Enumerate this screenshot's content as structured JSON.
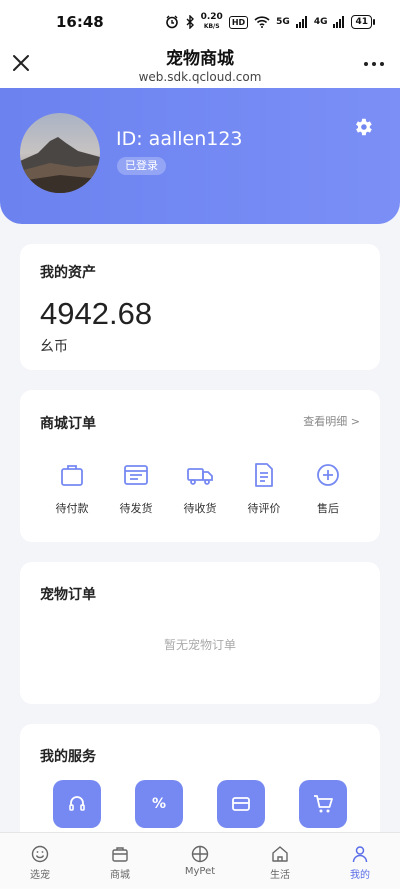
{
  "status_bar": {
    "time": "16:48",
    "speed_value": "0.20",
    "speed_unit": "KB/S",
    "hd": "HD",
    "net1": "5G",
    "net2": "4G",
    "battery": "41"
  },
  "title_bar": {
    "title": "宠物商城",
    "subtitle": "web.sdk.qcloud.com",
    "close_icon": "close-icon",
    "more_icon": "more-icon"
  },
  "profile": {
    "user_id": "ID: aallen123",
    "login_status": "已登录",
    "settings_icon": "gear-icon"
  },
  "assets": {
    "title": "我的资产",
    "value": "4942.68",
    "unit": "幺币"
  },
  "shop_orders": {
    "title": "商城订单",
    "view_detail": "查看明细 >",
    "items": [
      {
        "label": "待付款",
        "icon": "bag-icon"
      },
      {
        "label": "待发货",
        "icon": "package-icon"
      },
      {
        "label": "待收货",
        "icon": "truck-icon"
      },
      {
        "label": "待评价",
        "icon": "review-icon"
      },
      {
        "label": "售后",
        "icon": "plus-circle-icon"
      }
    ]
  },
  "pet_orders": {
    "title": "宠物订单",
    "empty_text": "暂无宠物订单"
  },
  "services": {
    "title": "我的服务",
    "items": [
      {
        "icon": "headset-icon"
      },
      {
        "icon": "percent-icon",
        "symbol": "%"
      },
      {
        "icon": "card-icon"
      },
      {
        "icon": "cart-icon"
      }
    ]
  },
  "bottom_nav": {
    "items": [
      {
        "label": "选宠",
        "icon": "smile-icon"
      },
      {
        "label": "商城",
        "icon": "bag-icon"
      },
      {
        "label": "MyPet",
        "icon": "compass-icon"
      },
      {
        "label": "生活",
        "icon": "home-icon"
      },
      {
        "label": "我的",
        "icon": "person-icon",
        "active": true
      }
    ]
  },
  "colors": {
    "accent": "#7689f2",
    "header_gradient_start": "#6b82ef",
    "active_nav": "#5a6de8"
  }
}
